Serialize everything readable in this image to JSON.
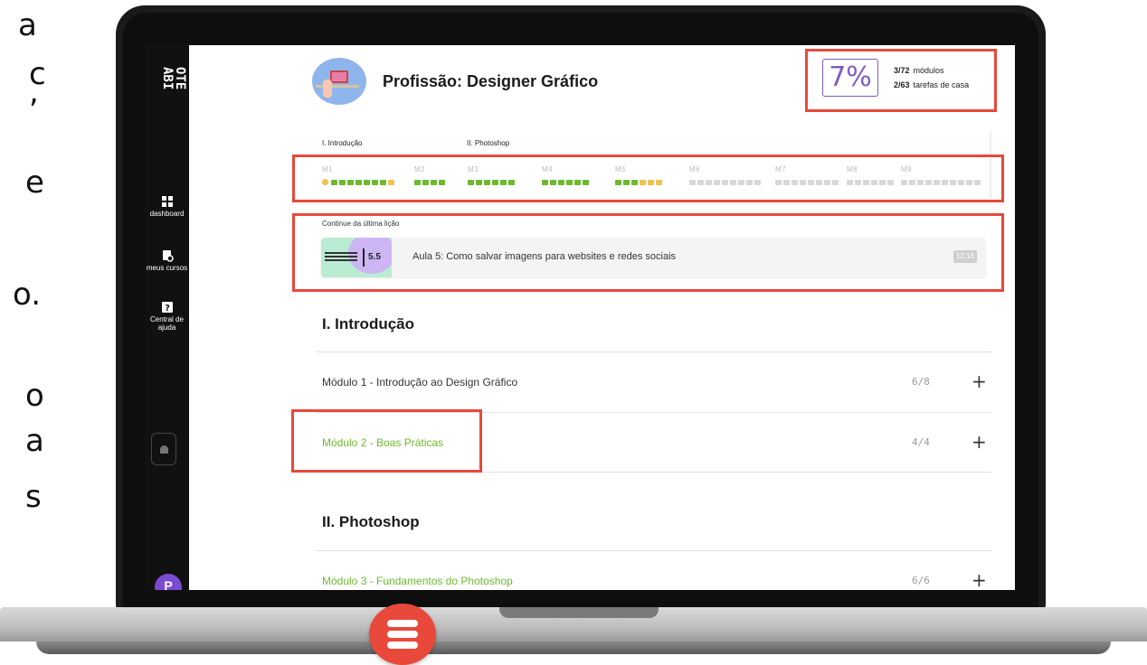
{
  "cut_text": {
    "lines": [
      "a",
      "c",
      ",",
      "e",
      "o.",
      "o",
      "a",
      "s"
    ]
  },
  "sidebar": {
    "logo": "OTE ABI",
    "items": [
      {
        "label": "dashboard",
        "icon": "dashboard-icon"
      },
      {
        "label": "meus cursos",
        "icon": "courses-icon"
      },
      {
        "label": "Central de ajuda",
        "icon": "help-icon"
      }
    ],
    "avatar_letter": "P"
  },
  "header": {
    "title": "Profissão: Designer Gráfico",
    "progress_percent": "7%",
    "modules_count": "3/72",
    "modules_label": "módulos",
    "homework_count": "2/63",
    "homework_label": "tarefas de casa"
  },
  "progress_strip": {
    "sections": [
      "I. Introdução",
      "II. Photoshop"
    ],
    "modules": [
      "M1",
      "M2",
      "M3",
      "M4",
      "M5",
      "M6",
      "M7",
      "M8",
      "M9"
    ]
  },
  "continue": {
    "label": "Continue da última lição",
    "lesson_number": "5.5",
    "lesson_title": "Aula 5: Como salvar imagens para websites e redes sociais",
    "duration": "12:18"
  },
  "sections": [
    {
      "title": "I. Introdução",
      "modules": [
        {
          "title": "Módulo 1 - Introdução ao Design Gráfico",
          "count": "6/8",
          "done": false
        },
        {
          "title": "Módulo 2 - Boas Práticas",
          "count": "4/4",
          "done": true
        }
      ]
    },
    {
      "title": "II. Photoshop",
      "modules": [
        {
          "title": "Módulo 3 - Fundamentos do Photoshop",
          "count": "6/6",
          "done": true
        }
      ]
    }
  ],
  "colors": {
    "highlight": "#e8493b",
    "accent_purple": "#7e5bc2",
    "done_green": "#6dba2d",
    "in_progress_yellow": "#f2c14e",
    "pending_gray": "#d9d9d9"
  }
}
